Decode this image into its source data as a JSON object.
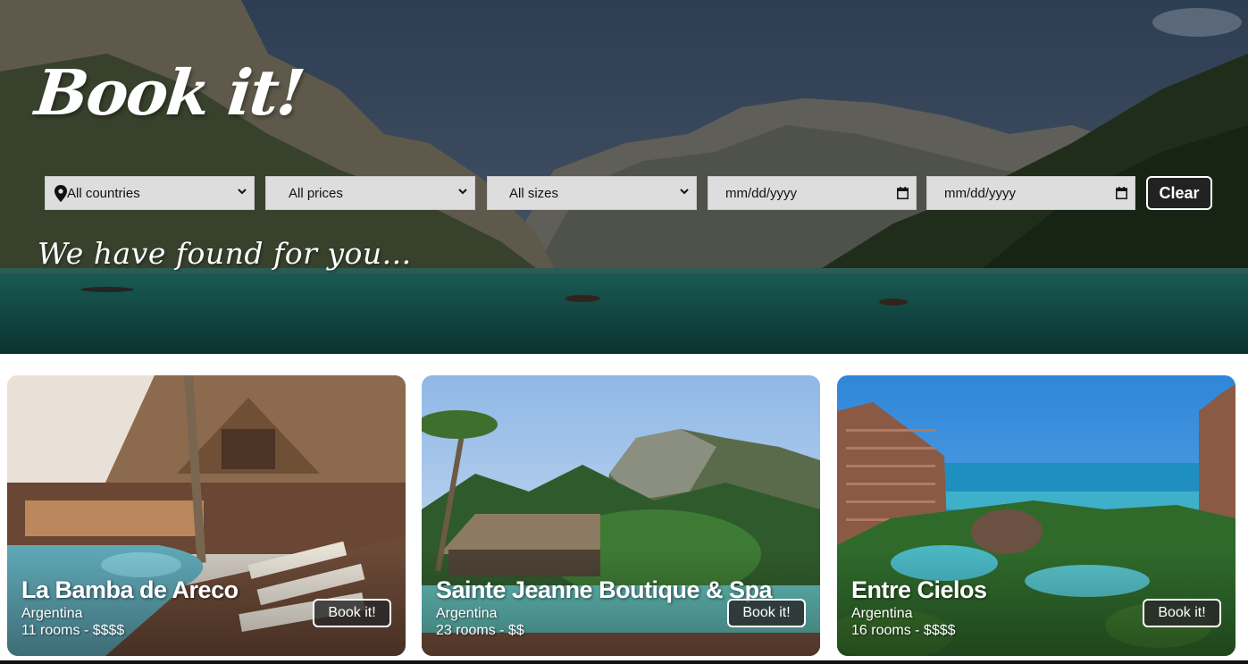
{
  "header": {
    "logo": "Book it!",
    "subtitle": "We have found for you..."
  },
  "filters": {
    "country": {
      "icon": "map-pin-icon",
      "selected": "All countries"
    },
    "price": {
      "selected": "All prices"
    },
    "size": {
      "selected": "All sizes"
    },
    "date_from": {
      "placeholder": "mm/dd/yyyy",
      "icon": "calendar-icon"
    },
    "date_to": {
      "placeholder": "mm/dd/yyyy",
      "icon": "calendar-icon"
    },
    "clear_label": "Clear"
  },
  "hotels": [
    {
      "name": "La Bamba de Areco",
      "country": "Argentina",
      "meta": "11 rooms - $$$$",
      "book_label": "Book it!"
    },
    {
      "name": "Sainte Jeanne Boutique & Spa",
      "country": "Argentina",
      "meta": "23 rooms - $$",
      "book_label": "Book it!"
    },
    {
      "name": "Entre Cielos",
      "country": "Argentina",
      "meta": "16 rooms - $$$$",
      "book_label": "Book it!"
    }
  ],
  "colors": {
    "button_bg": "#222222",
    "filter_bg": "#dddddd",
    "text_light": "#ffffff"
  }
}
